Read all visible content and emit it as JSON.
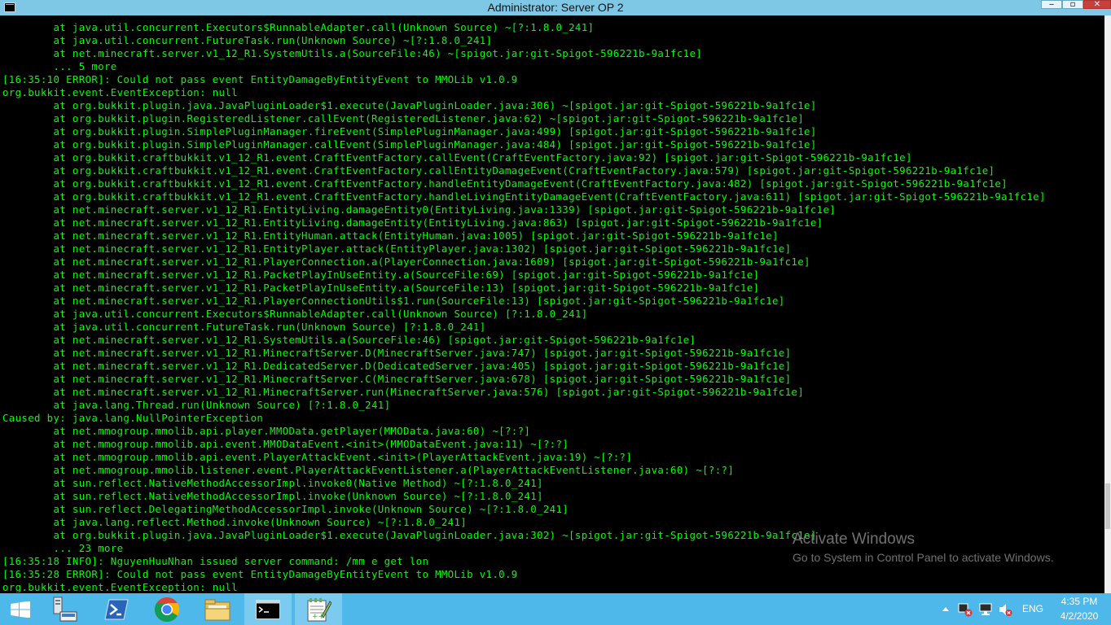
{
  "window": {
    "title": "Administrator:  Server OP 2",
    "controls": {
      "minimize": "‒",
      "maximize": "▫",
      "close": "✕"
    }
  },
  "console": {
    "lines": [
      "        at java.util.concurrent.Executors$RunnableAdapter.call(Unknown Source) ~[?:1.8.0_241]",
      "        at java.util.concurrent.FutureTask.run(Unknown Source) ~[?:1.8.0_241]",
      "        at net.minecraft.server.v1_12_R1.SystemUtils.a(SourceFile:46) ~[spigot.jar:git-Spigot-596221b-9a1fc1e]",
      "        ... 5 more",
      "[16:35:10 ERROR]: Could not pass event EntityDamageByEntityEvent to MMOLib v1.0.9",
      "org.bukkit.event.EventException: null",
      "        at org.bukkit.plugin.java.JavaPluginLoader$1.execute(JavaPluginLoader.java:306) ~[spigot.jar:git-Spigot-596221b-9a1fc1e]",
      "        at org.bukkit.plugin.RegisteredListener.callEvent(RegisteredListener.java:62) ~[spigot.jar:git-Spigot-596221b-9a1fc1e]",
      "        at org.bukkit.plugin.SimplePluginManager.fireEvent(SimplePluginManager.java:499) [spigot.jar:git-Spigot-596221b-9a1fc1e]",
      "        at org.bukkit.plugin.SimplePluginManager.callEvent(SimplePluginManager.java:484) [spigot.jar:git-Spigot-596221b-9a1fc1e]",
      "        at org.bukkit.craftbukkit.v1_12_R1.event.CraftEventFactory.callEvent(CraftEventFactory.java:92) [spigot.jar:git-Spigot-596221b-9a1fc1e]",
      "        at org.bukkit.craftbukkit.v1_12_R1.event.CraftEventFactory.callEntityDamageEvent(CraftEventFactory.java:579) [spigot.jar:git-Spigot-596221b-9a1fc1e]",
      "        at org.bukkit.craftbukkit.v1_12_R1.event.CraftEventFactory.handleEntityDamageEvent(CraftEventFactory.java:482) [spigot.jar:git-Spigot-596221b-9a1fc1e]",
      "        at org.bukkit.craftbukkit.v1_12_R1.event.CraftEventFactory.handleLivingEntityDamageEvent(CraftEventFactory.java:611) [spigot.jar:git-Spigot-596221b-9a1fc1e]",
      "        at net.minecraft.server.v1_12_R1.EntityLiving.damageEntity0(EntityLiving.java:1339) [spigot.jar:git-Spigot-596221b-9a1fc1e]",
      "        at net.minecraft.server.v1_12_R1.EntityLiving.damageEntity(EntityLiving.java:863) [spigot.jar:git-Spigot-596221b-9a1fc1e]",
      "        at net.minecraft.server.v1_12_R1.EntityHuman.attack(EntityHuman.java:1005) [spigot.jar:git-Spigot-596221b-9a1fc1e]",
      "        at net.minecraft.server.v1_12_R1.EntityPlayer.attack(EntityPlayer.java:1302) [spigot.jar:git-Spigot-596221b-9a1fc1e]",
      "        at net.minecraft.server.v1_12_R1.PlayerConnection.a(PlayerConnection.java:1609) [spigot.jar:git-Spigot-596221b-9a1fc1e]",
      "        at net.minecraft.server.v1_12_R1.PacketPlayInUseEntity.a(SourceFile:69) [spigot.jar:git-Spigot-596221b-9a1fc1e]",
      "        at net.minecraft.server.v1_12_R1.PacketPlayInUseEntity.a(SourceFile:13) [spigot.jar:git-Spigot-596221b-9a1fc1e]",
      "        at net.minecraft.server.v1_12_R1.PlayerConnectionUtils$1.run(SourceFile:13) [spigot.jar:git-Spigot-596221b-9a1fc1e]",
      "        at java.util.concurrent.Executors$RunnableAdapter.call(Unknown Source) [?:1.8.0_241]",
      "        at java.util.concurrent.FutureTask.run(Unknown Source) [?:1.8.0_241]",
      "        at net.minecraft.server.v1_12_R1.SystemUtils.a(SourceFile:46) [spigot.jar:git-Spigot-596221b-9a1fc1e]",
      "        at net.minecraft.server.v1_12_R1.MinecraftServer.D(MinecraftServer.java:747) [spigot.jar:git-Spigot-596221b-9a1fc1e]",
      "        at net.minecraft.server.v1_12_R1.DedicatedServer.D(DedicatedServer.java:405) [spigot.jar:git-Spigot-596221b-9a1fc1e]",
      "        at net.minecraft.server.v1_12_R1.MinecraftServer.C(MinecraftServer.java:678) [spigot.jar:git-Spigot-596221b-9a1fc1e]",
      "        at net.minecraft.server.v1_12_R1.MinecraftServer.run(MinecraftServer.java:576) [spigot.jar:git-Spigot-596221b-9a1fc1e]",
      "        at java.lang.Thread.run(Unknown Source) [?:1.8.0_241]",
      "Caused by: java.lang.NullPointerException",
      "        at net.mmogroup.mmolib.api.player.MMOData.getPlayer(MMOData.java:60) ~[?:?]",
      "        at net.mmogroup.mmolib.api.event.MMODataEvent.<init>(MMODataEvent.java:11) ~[?:?]",
      "        at net.mmogroup.mmolib.api.event.PlayerAttackEvent.<init>(PlayerAttackEvent.java:19) ~[?:?]",
      "        at net.mmogroup.mmolib.listener.event.PlayerAttackEventListener.a(PlayerAttackEventListener.java:60) ~[?:?]",
      "        at sun.reflect.NativeMethodAccessorImpl.invoke0(Native Method) ~[?:1.8.0_241]",
      "        at sun.reflect.NativeMethodAccessorImpl.invoke(Unknown Source) ~[?:1.8.0_241]",
      "        at sun.reflect.DelegatingMethodAccessorImpl.invoke(Unknown Source) ~[?:1.8.0_241]",
      "        at java.lang.reflect.Method.invoke(Unknown Source) ~[?:1.8.0_241]",
      "        at org.bukkit.plugin.java.JavaPluginLoader$1.execute(JavaPluginLoader.java:302) ~[spigot.jar:git-Spigot-596221b-9a1fc1e]",
      "        ... 23 more",
      "[16:35:18 INFO]: NguyenHuuNhan issued server command: /mm e get lon",
      "[16:35:28 ERROR]: Could not pass event EntityDamageByEntityEvent to MMOLib v1.0.9",
      "org.bukkit.event.EventException: null"
    ]
  },
  "watermark": {
    "heading": "Activate Windows",
    "subtext": "Go to System in Control Panel to activate Windows."
  },
  "taskbar": {
    "items": [
      {
        "name": "start-button",
        "icon": "windows-logo-icon"
      },
      {
        "name": "server-manager",
        "icon": "server-manager-icon"
      },
      {
        "name": "powershell",
        "icon": "powershell-icon"
      },
      {
        "name": "chrome",
        "icon": "chrome-icon"
      },
      {
        "name": "file-explorer",
        "icon": "folder-icon"
      },
      {
        "name": "command-prompt",
        "icon": "cmd-icon"
      },
      {
        "name": "notepad-plus-plus",
        "icon": "notepad-icon"
      }
    ],
    "tray": {
      "language": "ENG",
      "time": "4:35 PM",
      "date": "4/2/2020"
    }
  },
  "colors": {
    "console_text": "#00ff00",
    "console_bg": "#000000",
    "titlebar": "#7ec8e6",
    "taskbar": "#4fb8ea"
  }
}
